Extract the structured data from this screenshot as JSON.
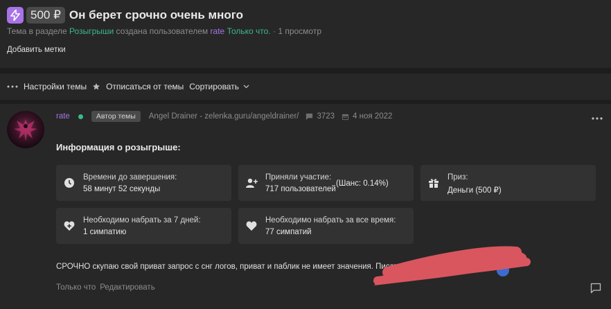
{
  "thread": {
    "price": "500 ₽",
    "title": "Он берет срочно очень много",
    "meta": {
      "prefix": "Тема в разделе",
      "section": "Розыгрыши",
      "created_by": "создана пользователем",
      "author": "rate",
      "time": "Только что.",
      "views": "· 1 просмотр"
    },
    "add_tags": "Добавить метки"
  },
  "toolbar": {
    "settings": "Настройки темы",
    "unsubscribe": "Отписаться от темы",
    "sort": "Сортировать"
  },
  "post": {
    "username": "rate",
    "author_badge": "Автор темы",
    "status": "Angel Drainer - zelenka.guru/angeldrainer/",
    "posts_count": "3723",
    "joined": "4 ноя 2022",
    "info_title": "Информация о розыгрыше:",
    "cards": {
      "time_left": {
        "label": "Времени до завершения:",
        "value": "58 минут 52 секунды",
        "icon": "clock-icon"
      },
      "participants": {
        "label": "Приняли участие:",
        "value": "717 пользователей",
        "extra": "(Шанс: 0.14%)",
        "icon": "user-plus-icon"
      },
      "prize": {
        "label": "Приз:",
        "value": "Деньги (500 ₽)",
        "icon": "gift-icon"
      },
      "likes_7d": {
        "label": "Необходимо набрать за 7 дней:",
        "value": "1 симпатию",
        "icon": "heart-plus-icon"
      },
      "likes_all": {
        "label": "Необходимо набрать за все время:",
        "value": "77 симпатий",
        "icon": "heart-icon"
      }
    },
    "text": "СРОЧНО скупаю свой приват запрос с снг логов, приват и паблик не имеет значения. Писат",
    "footer_time": "Только что",
    "edit": "Редактировать"
  },
  "colors": {
    "accent_purple": "#a873e8",
    "accent_green": "#3cb88b",
    "redaction": "#d9565f"
  }
}
